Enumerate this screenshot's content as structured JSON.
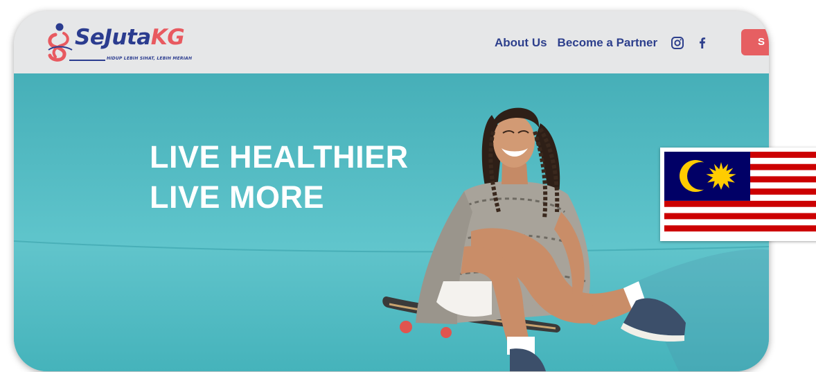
{
  "brand": {
    "name_part1": "SeJuta",
    "name_part2": "KG",
    "tagline": "HIDUP LEBIH SIHAT, LEBIH MERIAH"
  },
  "nav": {
    "links": [
      "About Us",
      "Become a Partner"
    ],
    "cta_label": "S"
  },
  "hero": {
    "headline_line1": "LIVE HEALTHIER",
    "headline_line2": "LIVE MORE"
  },
  "icons": {
    "instagram": "instagram-icon",
    "facebook": "facebook-icon",
    "flag": "malaysia-flag"
  },
  "colors": {
    "brand_blue": "#2b3c8f",
    "brand_red": "#e85a60",
    "cta": "#e65f62",
    "navbar_bg": "#e6e7e8",
    "hero_teal": "#5cc3ca"
  }
}
